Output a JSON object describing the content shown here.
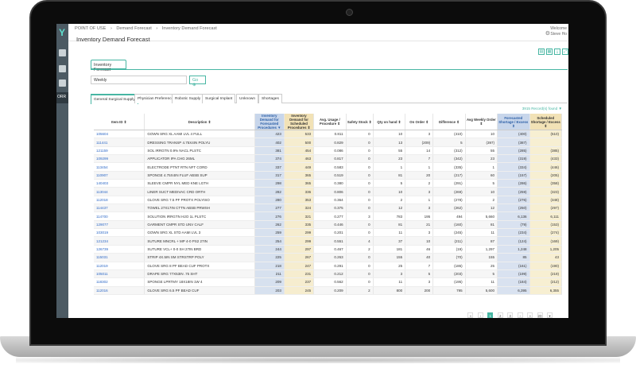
{
  "sidebar": {
    "logo": "Y",
    "active_label": "ORR"
  },
  "header": {
    "breadcrumb": [
      "POINT OF USE",
      "›",
      "Demand Forecast",
      "›",
      "Inventory Demand Forecast"
    ],
    "title": "Inventory Demand Forecast",
    "welcome": "Welcome",
    "user": "Steve Ho"
  },
  "toolbar": {
    "buttons": [
      "▤",
      "▦",
      "⤓",
      "⤢"
    ]
  },
  "forecast_tab": "Inventory Forecast",
  "filter": {
    "period": "Weekly",
    "go_label": "Go ⊕"
  },
  "tabs": [
    "General Surgical Supply",
    "Physician Preference",
    "Robotic Supply",
    "Surgical Implant",
    "Unknown",
    "Shortages"
  ],
  "records_found": "3915 Record(s) found",
  "columns": [
    "Item ID ⇕",
    "Description ⇕",
    "Inventory Demand for Forecasted Procedures ▼",
    "Inventory Demand for Scheduled Procedures ⇕",
    "Avg. Usage / Procedure ⇕",
    "Safety Stock ⇕",
    "Qty on hand ⇕",
    "On Order ⇕",
    "Difference ⇕",
    "Avg Weekly Order ⇕",
    "Forecasted Shortage / Excess ⇕",
    "Scheduled Shortage / Excess ⇕"
  ],
  "rows": [
    [
      "105604",
      "GOWN SRG XL AAMI LVL 4 FULL",
      "423",
      "533",
      "0.811",
      "0",
      "10",
      "3",
      "(410)",
      "10",
      "(400)",
      "(510)"
    ],
    [
      "111441",
      "DRESSING TRANSP 4.75X4IN POLYU",
      "402",
      "500",
      "0.829",
      "0",
      "13",
      "(209)",
      "5",
      "(397)",
      "(387)",
      ""
    ],
    [
      "121159",
      "SOL IRRGTN 0.9% NACL PLSTC",
      "381",
      "454",
      "0.086",
      "0",
      "55",
      "14",
      "(312)",
      "55",
      "(285)",
      "(385)"
    ],
    [
      "109299",
      "APPLICATOR IPA CHG 26ML",
      "374",
      "463",
      "0.817",
      "0",
      "23",
      "7",
      "(342)",
      "23",
      "(319)",
      "(433)"
    ],
    [
      "113454",
      "ELECTRODE PTNT RTN NFT CORD",
      "337",
      "449",
      "0.583",
      "0",
      "1",
      "1",
      "(335)",
      "1",
      "(334)",
      "(446)"
    ],
    [
      "110907",
      "SPONGE 4.75X4IN FLUF ABSB SUP",
      "317",
      "365",
      "0.519",
      "0",
      "81",
      "20",
      "(217)",
      "60",
      "(157)",
      "(205)"
    ],
    [
      "140403",
      "SLEEVE CMPR NYL MED KNE LGTH",
      "298",
      "365",
      "0.380",
      "0",
      "5",
      "2",
      "(291)",
      "5",
      "(286)",
      "(358)"
    ],
    [
      "113044",
      "LINER SUCT MEDIVAC CRD ORTH",
      "282",
      "336",
      "0.806",
      "0",
      "10",
      "3",
      "(269)",
      "10",
      "(259)",
      "(323)"
    ],
    [
      "112018",
      "GLOVE SRG 7.5 PF PROTX POLYISO",
      "280",
      "353",
      "0.364",
      "0",
      "2",
      "1",
      "(278)",
      "2",
      "(276)",
      "(348)"
    ],
    [
      "114437",
      "TOWEL 27X17IN CTTN ABSB PRWSH",
      "277",
      "324",
      "0.375",
      "0",
      "12",
      "3",
      "(262)",
      "12",
      "(250)",
      "(297)"
    ],
    [
      "114700",
      "SOLUTION IRRGTN H2O 1L PLSTC",
      "276",
      "321",
      "0.277",
      "3",
      "783",
      "195",
      "494",
      "5,660",
      "6,136",
      "6,111"
    ],
    [
      "129077",
      "GARMENT CMPR STD UNV CALF",
      "262",
      "335",
      "0.446",
      "0",
      "81",
      "21",
      "(160)",
      "81",
      "(79)",
      "(153)"
    ],
    [
      "103019",
      "GOWN SRG XL STD AAMI LVL 3",
      "259",
      "299",
      "0.201",
      "0",
      "11",
      "3",
      "(245)",
      "11",
      "(234)",
      "(274)"
    ],
    [
      "121234",
      "SUTURE MNCRL + MP 4-0 PS2 27IN",
      "254",
      "299",
      "0.551",
      "4",
      "37",
      "10",
      "(211)",
      "87",
      "(124)",
      "(169)"
    ],
    [
      "126739",
      "SUTURE VCL+ 0-0 SH 27IN BRD",
      "244",
      "297",
      "0.467",
      "2",
      "181",
      "46",
      "(19)",
      "1,297",
      "1,248",
      "1,205"
    ],
    [
      "115031",
      "STRIP 4X.5IN SM STRSTRP POLY",
      "225",
      "267",
      "0.263",
      "0",
      "155",
      "40",
      "(70)",
      "155",
      "85",
      "43"
    ],
    [
      "112019",
      "GLOVE SRG 8 PF BEAD CUF PROTX",
      "218",
      "247",
      "0.291",
      "0",
      "25",
      "7",
      "(186)",
      "25",
      "(161)",
      "(190)"
    ],
    [
      "105011",
      "DRAPE SRG 77X53IN .75 SHT",
      "211",
      "231",
      "0.212",
      "0",
      "3",
      "5",
      "(203)",
      "5",
      "(199)",
      "(219)"
    ],
    [
      "118302",
      "SPONGE LPRTMY 18X18IN 1W 4",
      "209",
      "237",
      "0.562",
      "0",
      "11",
      "3",
      "(195)",
      "11",
      "(184)",
      "(212)"
    ],
    [
      "112016",
      "GLOVE SRG 6.5 PF BEAD CUF",
      "203",
      "245",
      "0.209",
      "2",
      "800",
      "200",
      "795",
      "5,600",
      "6,395",
      "6,355"
    ]
  ],
  "pagination": [
    "«",
    "‹",
    "1",
    "2",
    "3",
    "›",
    "»",
    "20",
    "▾"
  ]
}
